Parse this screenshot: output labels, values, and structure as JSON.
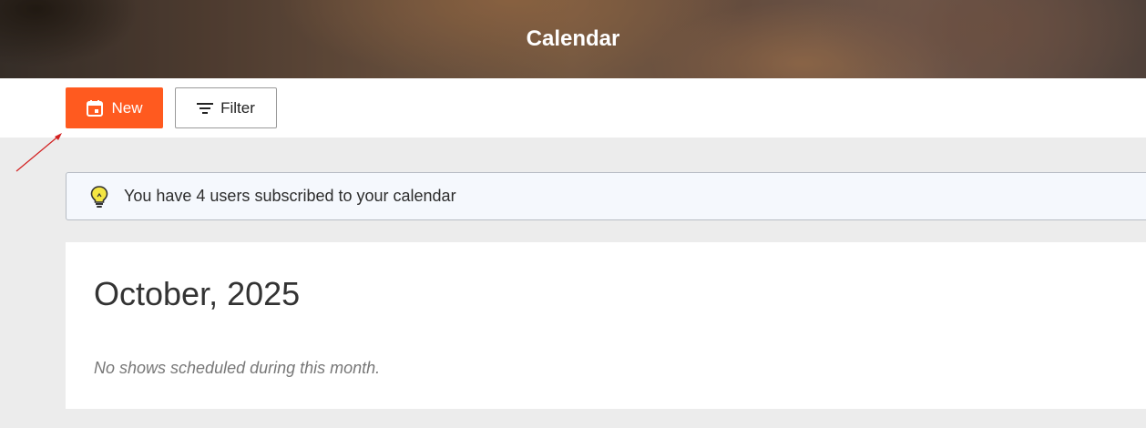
{
  "header": {
    "title": "Calendar"
  },
  "toolbar": {
    "new_label": "New",
    "filter_label": "Filter"
  },
  "notice": {
    "text": "You have 4 users subscribed to your calendar"
  },
  "calendar": {
    "month_title": "October, 2025",
    "empty_message": "No shows scheduled during this month."
  },
  "icons": {
    "new": "calendar-icon",
    "filter": "filter-icon",
    "notice": "lightbulb-icon"
  },
  "colors": {
    "accent": "#ff5a1f",
    "annotation_arrow": "#d32020"
  }
}
